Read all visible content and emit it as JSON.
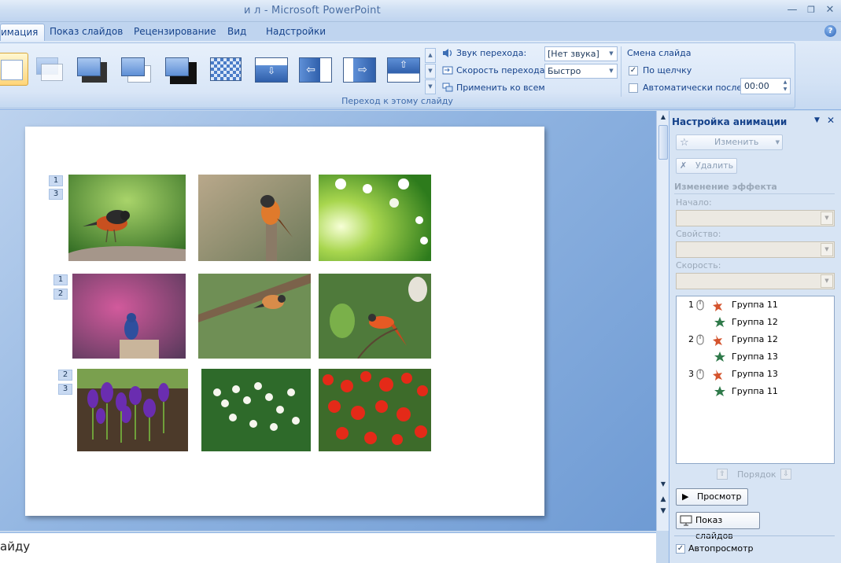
{
  "window": {
    "title": "и л - Microsoft PowerPoint",
    "controls": [
      "minimize",
      "restore",
      "close"
    ]
  },
  "ribbon_tabs": [
    {
      "label": "имация",
      "active": true
    },
    {
      "label": "Показ слайдов",
      "active": false
    },
    {
      "label": "Рецензирование",
      "active": false
    },
    {
      "label": "Вид",
      "active": false
    },
    {
      "label": "Надстройки",
      "active": false
    }
  ],
  "transitions_group": {
    "label": "Переход к этому слайду",
    "gallery_items": [
      "no-transition",
      "fade-smoothly",
      "fade-through-black",
      "cut",
      "cut-through-black",
      "dissolve",
      "wipe-down",
      "wipe-left",
      "wipe-right",
      "wipe-up"
    ],
    "sound_label": "Звук перехода:",
    "sound_value": "[Нет звука]",
    "speed_label": "Скорость перехода:",
    "speed_value": "Быстро",
    "apply_all_label": "Применить ко всем"
  },
  "advance_group": {
    "title": "Смена слайда",
    "on_click_label": "По щелчку",
    "on_click_checked": true,
    "auto_label": "Автоматически после:",
    "auto_checked": false,
    "auto_time": "00:00"
  },
  "slide": {
    "order_tags": [
      {
        "row": 1,
        "tags": [
          "1",
          "3"
        ]
      },
      {
        "row": 2,
        "tags": [
          "1",
          "2"
        ]
      },
      {
        "row": 3,
        "tags": [
          "2",
          "3"
        ]
      }
    ],
    "photos": [
      "redstart-on-stone",
      "redstart-on-stump",
      "white-blossoms",
      "bluebird-on-post",
      "bird-on-branch",
      "redstart-on-twig",
      "purple-crocuses",
      "lily-of-the-valley",
      "red-poppies"
    ]
  },
  "notes": {
    "text": "айду"
  },
  "task_pane": {
    "title": "Настройка анимации",
    "change_button": "Изменить",
    "delete_button": "Удалить",
    "section_title": "Изменение эффекта",
    "start_label": "Начало:",
    "property_label": "Свойство:",
    "speed_label": "Скорость:",
    "animations": [
      {
        "num": "1",
        "trigger": true,
        "effect": "emphasis",
        "label": "Группа 11"
      },
      {
        "num": "",
        "trigger": false,
        "effect": "entrance",
        "label": "Группа 12"
      },
      {
        "num": "2",
        "trigger": true,
        "effect": "emphasis",
        "label": "Группа 12"
      },
      {
        "num": "",
        "trigger": false,
        "effect": "entrance",
        "label": "Группа 13"
      },
      {
        "num": "3",
        "trigger": true,
        "effect": "emphasis",
        "label": "Группа 13"
      },
      {
        "num": "",
        "trigger": false,
        "effect": "entrance",
        "label": "Группа 11"
      }
    ],
    "reorder_label": "Порядок",
    "preview_button": "Просмотр",
    "slideshow_button": "Показ слайдов",
    "autopreview_label": "Автопросмотр",
    "autopreview_checked": true
  },
  "colors": {
    "ribbon_text": "#15428b",
    "workspace_dark": "#6f9bd4",
    "selection": "#ffd57a"
  }
}
